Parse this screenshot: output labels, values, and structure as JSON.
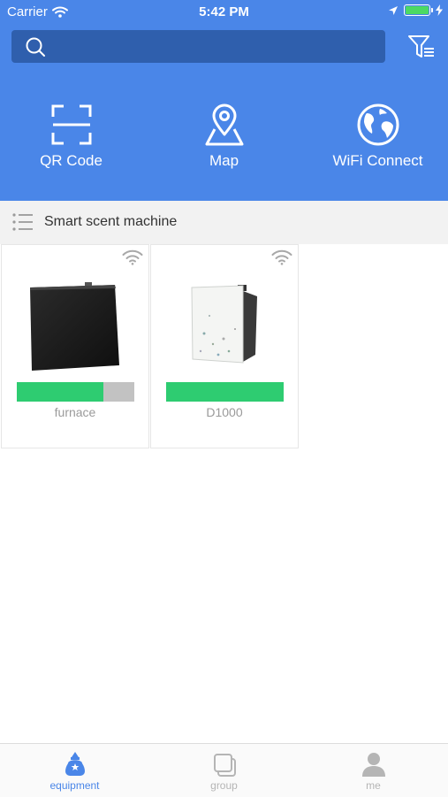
{
  "status_bar": {
    "carrier": "Carrier",
    "time": "5:42 PM",
    "battery_percent": 100
  },
  "search": {
    "placeholder": "",
    "value": ""
  },
  "quick_actions": [
    {
      "label": "QR Code",
      "icon": "qr-scan-icon"
    },
    {
      "label": "Map",
      "icon": "map-pin-icon"
    },
    {
      "label": "WiFi Connect",
      "icon": "globe-icon"
    }
  ],
  "category": {
    "label": "Smart scent machine",
    "icon": "list-icon"
  },
  "devices": [
    {
      "name": "furnace",
      "level_percent": 74,
      "online": true,
      "image": "black-cabinet"
    },
    {
      "name": "D1000",
      "level_percent": 100,
      "online": true,
      "image": "white-cabinet"
    }
  ],
  "tabs": [
    {
      "label": "equipment",
      "icon": "scent-drop-icon",
      "active": true
    },
    {
      "label": "group",
      "icon": "group-icon",
      "active": false
    },
    {
      "label": "me",
      "icon": "person-icon",
      "active": false
    }
  ],
  "colors": {
    "header_bg": "#4a86e8",
    "search_bg": "#2f5fad",
    "level_fill": "#2ecc71",
    "level_empty": "#c2c2c2",
    "tab_active": "#4a86e8",
    "tab_inactive": "#b5b5b5"
  }
}
